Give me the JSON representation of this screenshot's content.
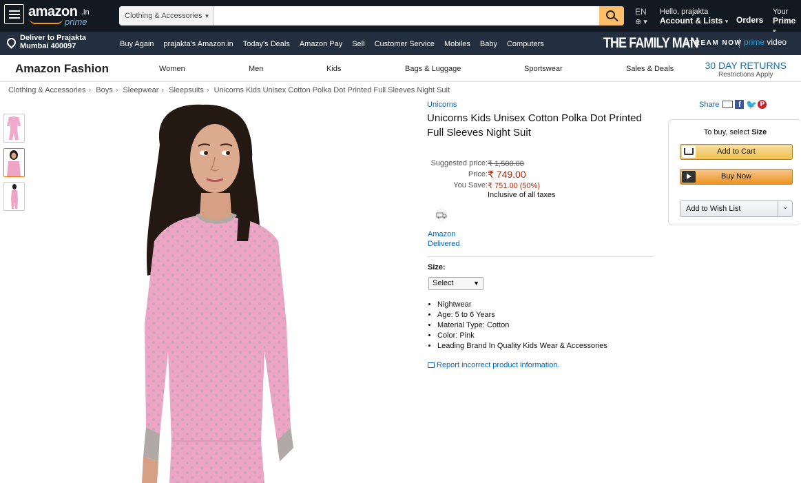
{
  "nav": {
    "logo_text": "amazon",
    "logo_suffix": ".in",
    "logo_prime": "prime",
    "search_category": "Clothing & Accessories",
    "search_placeholder": "",
    "lang": "EN",
    "greeting": "Hello, prajakta",
    "account_lists": "Account & Lists",
    "orders": "Orders",
    "your": "Your",
    "prime": "Prime"
  },
  "subnav": {
    "deliver_line1": "Deliver to Prajakta",
    "deliver_line2": "Mumbai 400097",
    "links": [
      "Buy Again",
      "prajakta's Amazon.in",
      "Today's Deals",
      "Amazon Pay",
      "Sell",
      "Customer Service",
      "Mobiles",
      "Baby",
      "Computers"
    ],
    "promo_show": "THE FAMILY MAN",
    "promo_stream": "STREAM NOW",
    "promo_prime": "prime",
    "promo_video": "video"
  },
  "fashion_bar": {
    "title": "Amazon Fashion",
    "links": [
      "Women",
      "Men",
      "Kids",
      "Bags & Luggage",
      "Sportswear",
      "Sales & Deals"
    ],
    "returns_big": "30 DAY RETURNS",
    "returns_small": "Restrictions Apply"
  },
  "breadcrumb": [
    "Clothing & Accessories",
    "Boys",
    "Sleepwear",
    "Sleepsuits",
    "Unicorns Kids Unisex Cotton Polka Dot Printed Full Sleeves Night Suit"
  ],
  "product": {
    "brand": "Unicorns",
    "title": "Unicorns Kids Unisex Cotton Polka Dot Printed Full Sleeves Night Suit",
    "suggested_label": "Suggested price:",
    "suggested_value": "₹ 1,500.00",
    "price_label": "Price:",
    "price_value": "₹ 749.00",
    "save_label": "You Save:",
    "save_value": "₹ 751.00 (50%)",
    "taxes": "Inclusive of all taxes",
    "delivered_line1": "Amazon",
    "delivered_line2": "Delivered",
    "size_label": "Size:",
    "size_selected": "Select",
    "bullets": [
      "Nightwear",
      "Age: 5 to 6 Years",
      "Material Type: Cotton",
      "Color: Pink",
      "Leading Brand In Quality Kids Wear & Accessories"
    ],
    "report": "Report incorrect product information."
  },
  "share": {
    "label": "Share"
  },
  "buybox": {
    "to_buy_prefix": "To buy, select ",
    "to_buy_bold": "Size",
    "add_to_cart": "Add to Cart",
    "buy_now": "Buy Now",
    "wish_list": "Add to Wish List"
  },
  "colors": {
    "nav_dark": "#131921",
    "subnav": "#232f3e",
    "search_button": "#febd69",
    "link_blue": "#0066c0",
    "price_red": "#b12704",
    "garment_pink": "#eea4c4"
  }
}
